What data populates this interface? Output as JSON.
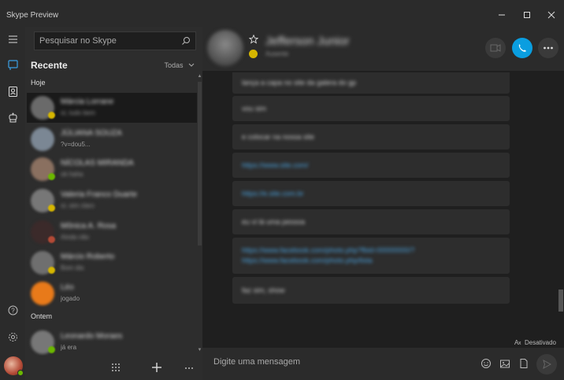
{
  "app": {
    "title": "Skype Preview"
  },
  "search": {
    "placeholder": "Pesquisar no Skype"
  },
  "sidebar": {
    "recent_label": "Recente",
    "filter_label": "Todas",
    "groups": [
      {
        "label": "Hoje"
      },
      {
        "label": "Ontem"
      }
    ],
    "conversations": [
      {
        "name": "Márcia Lorrane",
        "preview": "oi, tudo bem",
        "avatar_color": "#6a6a6a",
        "status_color": "#d6b600",
        "active": true
      },
      {
        "name": "JÚLIANA SOUZA",
        "preview": "https://www.youtube.com/watch?v=dou5...",
        "preview_visible": "?v=dou5...",
        "avatar_color": "#7b8794",
        "status_color": "",
        "active": false
      },
      {
        "name": "NÍCOLAS MIRANDA",
        "preview": "ok haha",
        "avatar_color": "#8a7060",
        "status_color": "#6bb700",
        "active": false
      },
      {
        "name": "Valeria Franco Duarte",
        "preview": "oi, sim claro",
        "avatar_color": "#777777",
        "status_color": "#d6b600",
        "active": false
      },
      {
        "name": "Mônica A. Rosa",
        "preview": "Ainda não",
        "avatar_color": "#3b2a2a",
        "status_color": "#b34a36",
        "active": false
      },
      {
        "name": "Márcio Roberto",
        "preview": "Bom dia",
        "avatar_color": "#6f6f6f",
        "status_color": "#d6b600",
        "active": false
      },
      {
        "name": "Léo",
        "preview": "você tá jogado",
        "preview_visible": "jogado",
        "avatar_color": "#e87a1a",
        "status_color": "",
        "active": false
      },
      {
        "name": "Leonardo Moraes",
        "preview": "ta de sacanagem? kkkk já era",
        "preview_visible": "já era",
        "avatar_color": "#777777",
        "status_color": "#6bb700",
        "active": false
      }
    ]
  },
  "chat": {
    "contact_name": "Jefferson Junior",
    "contact_status": "Ausente",
    "messages": [
      {
        "text": "lança a capa no site da galera do gp"
      },
      {
        "text": "vou sim"
      },
      {
        "text": "e colocar na nossa site"
      },
      {
        "text": "https://www.site.com/",
        "link": true
      },
      {
        "text": "https://e.site.com.br",
        "link": true
      },
      {
        "text": "eu vi lá uma pessoa"
      },
      {
        "text": "https://www.facebook.com/photo.php?fbid=00000000/?",
        "text2": "https://www.facebook.com/photo.php/lista",
        "link": true
      },
      {
        "text": "faz sim, show"
      }
    ],
    "translator_label": "Desativado",
    "composer_placeholder": "Digite uma mensagem"
  },
  "colors": {
    "accent_call": "#0a9ee0",
    "status_away": "#d6b600",
    "status_online": "#6bb700",
    "link": "#4aa3e0"
  },
  "icons": {
    "rail": [
      "chat-icon",
      "contacts-icon",
      "bots-icon",
      "help-icon",
      "settings-icon"
    ],
    "header": [
      "video-call-icon",
      "audio-call-icon",
      "more-icon"
    ],
    "composer": [
      "emoji-icon",
      "image-icon",
      "file-icon",
      "send-icon"
    ]
  }
}
